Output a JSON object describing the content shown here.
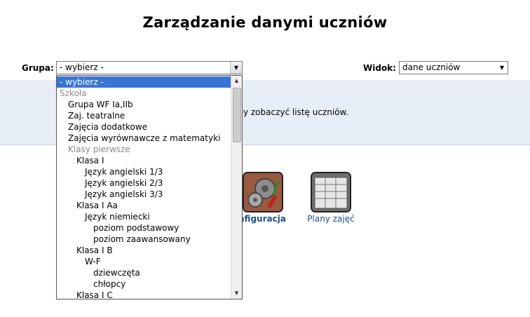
{
  "page_title": "Zarządzanie danymi uczniów",
  "group_filter": {
    "label": "Grupa:",
    "value": "- wybierz -"
  },
  "view_filter": {
    "label": "Widok:",
    "value": "dane uczniów"
  },
  "info_message": "aby zobaczyć listę uczniów.",
  "tiles": [
    {
      "label": "nfiguracja",
      "icon": "gears-icon"
    },
    {
      "label": "Plany zajęć",
      "icon": "schedule-icon"
    }
  ],
  "dropdown_options": [
    {
      "label": "- wybierz -",
      "level": 0,
      "selected": true,
      "group": false
    },
    {
      "label": "Szkoła",
      "level": 0,
      "selected": false,
      "group": true
    },
    {
      "label": "Grupa WF Ia,IIb",
      "level": 1,
      "selected": false,
      "group": false
    },
    {
      "label": "Zaj. teatralne",
      "level": 1,
      "selected": false,
      "group": false
    },
    {
      "label": "Zajęcia dodatkowe",
      "level": 1,
      "selected": false,
      "group": false
    },
    {
      "label": "Zajęcia wyrównawcze z matematyki",
      "level": 1,
      "selected": false,
      "group": false
    },
    {
      "label": "Klasy pierwsze",
      "level": 1,
      "selected": false,
      "group": true
    },
    {
      "label": "Klasa I",
      "level": 2,
      "selected": false,
      "group": false
    },
    {
      "label": "Język angielski 1/3",
      "level": 3,
      "selected": false,
      "group": false
    },
    {
      "label": "Język angielski 2/3",
      "level": 3,
      "selected": false,
      "group": false
    },
    {
      "label": "Język angielski 3/3",
      "level": 3,
      "selected": false,
      "group": false
    },
    {
      "label": "Klasa I Aa",
      "level": 2,
      "selected": false,
      "group": false
    },
    {
      "label": "Język niemiecki",
      "level": 3,
      "selected": false,
      "group": false
    },
    {
      "label": "poziom podstawowy",
      "level": 4,
      "selected": false,
      "group": false
    },
    {
      "label": "poziom zaawansowany",
      "level": 4,
      "selected": false,
      "group": false
    },
    {
      "label": "Klasa I B",
      "level": 2,
      "selected": false,
      "group": false
    },
    {
      "label": "W-F",
      "level": 3,
      "selected": false,
      "group": false
    },
    {
      "label": "dziewczęta",
      "level": 4,
      "selected": false,
      "group": false
    },
    {
      "label": "chłopcy",
      "level": 4,
      "selected": false,
      "group": false
    },
    {
      "label": "Klasa I C",
      "level": 2,
      "selected": false,
      "group": false
    }
  ],
  "colors": {
    "selection": "#3875d7",
    "link": "#1f4e8c",
    "band": "#e8eef7"
  }
}
